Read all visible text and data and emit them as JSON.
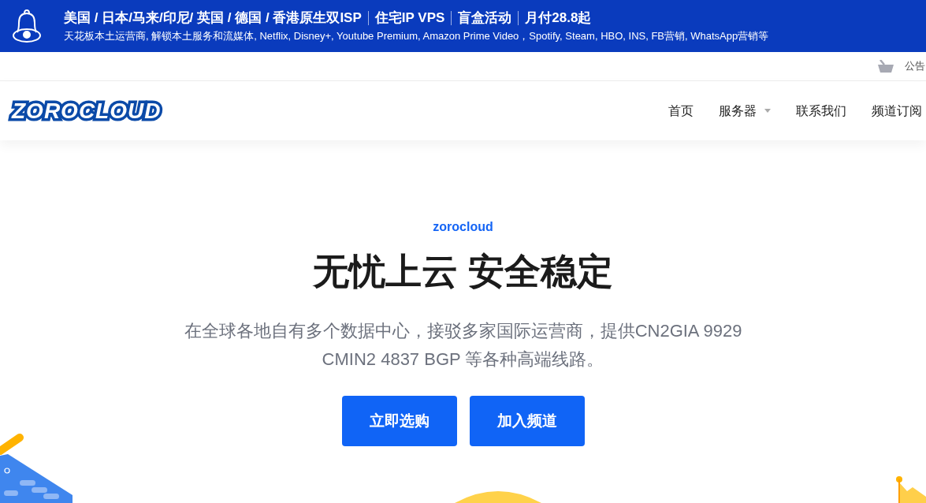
{
  "announcement": {
    "headline": [
      "美国 / 日本/马来/印尼/ 英国 / 德国 / 香港原生双ISP",
      "住宅IP VPS",
      "盲盒活动",
      "月付28.8起"
    ],
    "subline": "天花板本土运营商, 解锁本土服务和流媒体, Netflix, Disney+, Youtube Premium, Amazon Prime Video，Spotify, Steam, HBO, INS, FB营销, WhatsApp营销等"
  },
  "top_bar": {
    "notice": "公告"
  },
  "header": {
    "logo": "ZOROCLOUD",
    "nav": [
      {
        "label": "首页",
        "dropdown": false
      },
      {
        "label": "服务器",
        "dropdown": true
      },
      {
        "label": "联系我们",
        "dropdown": false
      },
      {
        "label": "频道订阅",
        "dropdown": false
      }
    ]
  },
  "hero": {
    "eyebrow": "zorocloud",
    "title": "无忧上云 安全稳定",
    "description": "在全球各地自有多个数据中心，接驳多家国际运营商，提供CN2GIA 9929 CMIN2 4837 BGP 等各种高端线路。",
    "buttons": [
      "立即选购",
      "加入频道"
    ]
  }
}
